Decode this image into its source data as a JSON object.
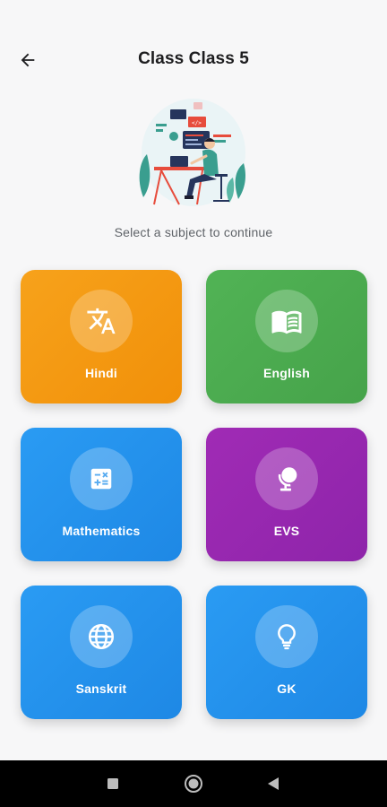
{
  "status_bar": {
    "time": "",
    "indicators": ""
  },
  "app_bar": {
    "back_icon": "arrow-left-icon",
    "title": "Class Class 5"
  },
  "illustration": {
    "subject": "person-at-desk-with-computer"
  },
  "subtitle": "Select a subject to continue",
  "subjects": [
    {
      "label": "Hindi",
      "icon": "translate-icon",
      "color": "#f49a0f"
    },
    {
      "label": "English",
      "icon": "book-icon",
      "color": "#4caf50"
    },
    {
      "label": "Mathematics",
      "icon": "calculator-icon",
      "color": "#2196f3"
    },
    {
      "label": "EVS",
      "icon": "globe-stand-icon",
      "color": "#9c27b0"
    },
    {
      "label": "Sanskrit",
      "icon": "globe-icon",
      "color": "#2196f3"
    },
    {
      "label": "GK",
      "icon": "lightbulb-icon",
      "color": "#2196f3"
    }
  ],
  "nav_bar": {
    "buttons": [
      "recents-square-icon",
      "home-circle-icon",
      "back-triangle-icon"
    ]
  }
}
